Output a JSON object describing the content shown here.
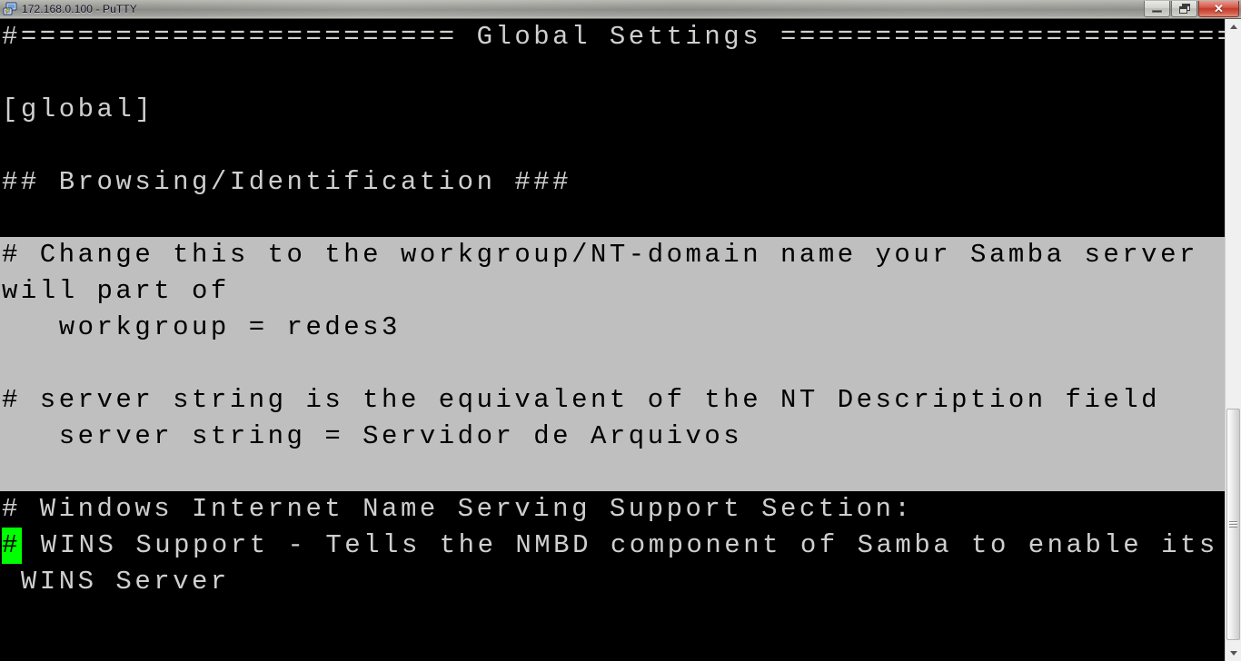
{
  "window": {
    "title": "172.168.0.100 - PuTTY",
    "icon": "putty-computer-icon",
    "controls": {
      "minimize_label": "–",
      "restore_label": "❐",
      "close_label": "✕"
    }
  },
  "colors": {
    "terminal_background": "#000000",
    "terminal_foreground": "#cfcfcf",
    "selection_background": "#bfbfbf",
    "selection_foreground": "#000000",
    "cursor_background": "#00ff00",
    "cursor_foreground": "#000000",
    "titlebar_text": "#14142b",
    "close_button": "#c33b29"
  },
  "terminal": {
    "lines": [
      {
        "id": "line-1",
        "text": "#======================= Global Settings =========================",
        "selected": false
      },
      {
        "id": "line-2",
        "text": "",
        "selected": false
      },
      {
        "id": "line-3",
        "text": "[global]",
        "selected": false
      },
      {
        "id": "line-4",
        "text": "",
        "selected": false
      },
      {
        "id": "line-5",
        "text": "## Browsing/Identification ###",
        "selected": false
      },
      {
        "id": "line-6",
        "text": "",
        "selected": false
      },
      {
        "id": "line-7",
        "text": "# Change this to the workgroup/NT-domain name your Samba server",
        "selected": true
      },
      {
        "id": "line-8",
        "text": "will part of",
        "selected": true
      },
      {
        "id": "line-9",
        "text": "   workgroup = redes3",
        "selected": true
      },
      {
        "id": "line-10",
        "text": "",
        "selected": true
      },
      {
        "id": "line-11",
        "text": "# server string is the equivalent of the NT Description field",
        "selected": true
      },
      {
        "id": "line-12",
        "text": "   server string = Servidor de Arquivos",
        "selected": true
      },
      {
        "id": "line-13",
        "text": "",
        "selected": true
      },
      {
        "id": "line-14",
        "text": "# Windows Internet Name Serving Support Section:",
        "selected": false
      },
      {
        "id": "line-15",
        "text": "# WINS Support - Tells the NMBD component of Samba to enable its",
        "selected": false,
        "cursor_col": 0
      },
      {
        "id": "line-16",
        "text": " WINS Server",
        "selected": false
      }
    ]
  },
  "scrollbar": {
    "up_arrow": "scroll-up-arrow",
    "down_arrow": "scroll-down-arrow",
    "thumb": "scroll-thumb"
  }
}
